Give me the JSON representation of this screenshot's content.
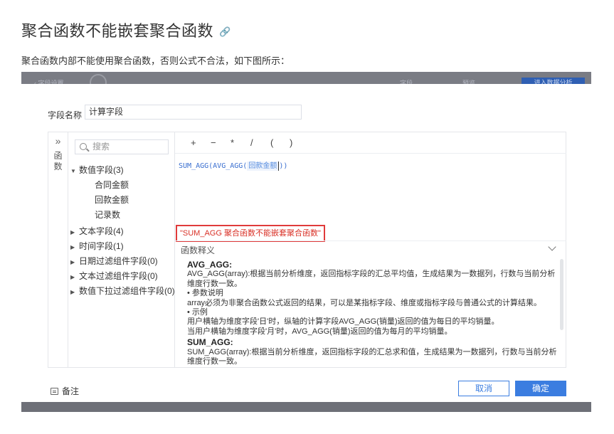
{
  "doc": {
    "title": "聚合函数不能嵌套聚合函数",
    "description": "聚合函数内部不能使用聚合函数，否则公式不合法，如下图所示："
  },
  "screenshot_top": {
    "left_text": "‹ 字段设置",
    "mid_text": "字段",
    "mid_text2": "预览",
    "button_text": "进入数据分析"
  },
  "dialog": {
    "field_name_label": "字段名称",
    "field_name_value": "计算字段",
    "side_tab": {
      "label": "函数"
    },
    "search_placeholder": "搜索",
    "tree": {
      "value_fields": "数值字段(3)",
      "value_children": [
        "合同金额",
        "回款金额",
        "记录数"
      ],
      "text_fields": "文本字段(4)",
      "time_fields": "时间字段(1)",
      "date_filter": "日期过滤组件字段(0)",
      "text_filter": "文本过滤组件字段(0)",
      "value_dropdown": "数值下拉过滤组件字段(0)"
    },
    "operators": [
      "+",
      "−",
      "*",
      "/",
      "(",
      ")"
    ],
    "formula": {
      "prefix": "SUM_AGG(AVG_AGG(",
      "field": "回款金额",
      "suffix": "))"
    },
    "error_message": "\"SUM_AGG 聚合函数不能嵌套聚合函数\"",
    "func_section_title": "函数释义",
    "func_doc": {
      "avg_name": "AVG_AGG:",
      "avg_desc": "AVG_AGG(array):根据当前分析维度，返回指标字段的汇总平均值，生成结果为一数据列，行数与当前分析维度行数一致。",
      "param_title": "• 参数说明",
      "param_desc": "array必须为非聚合函数公式返回的结果，可以是某指标字段、维度或指标字段与普通公式的计算结果。",
      "example_title": "• 示例",
      "example_1": "用户横轴为维度字段'日'时，纵轴的计算字段AVG_AGG(销量)返回的值为每日的平均销量。",
      "example_2": "当用户横轴为维度字段'月'时，AVG_AGG(销量)返回的值为每月的平均销量。",
      "sum_name": "SUM_AGG:",
      "sum_desc": "SUM_AGG(array):根据当前分析维度，返回指标字段的汇总求和值，生成结果为一数据列，行数与当前分析维度行数一致。"
    },
    "note_label": "备注",
    "cancel_label": "取消",
    "ok_label": "确定"
  }
}
